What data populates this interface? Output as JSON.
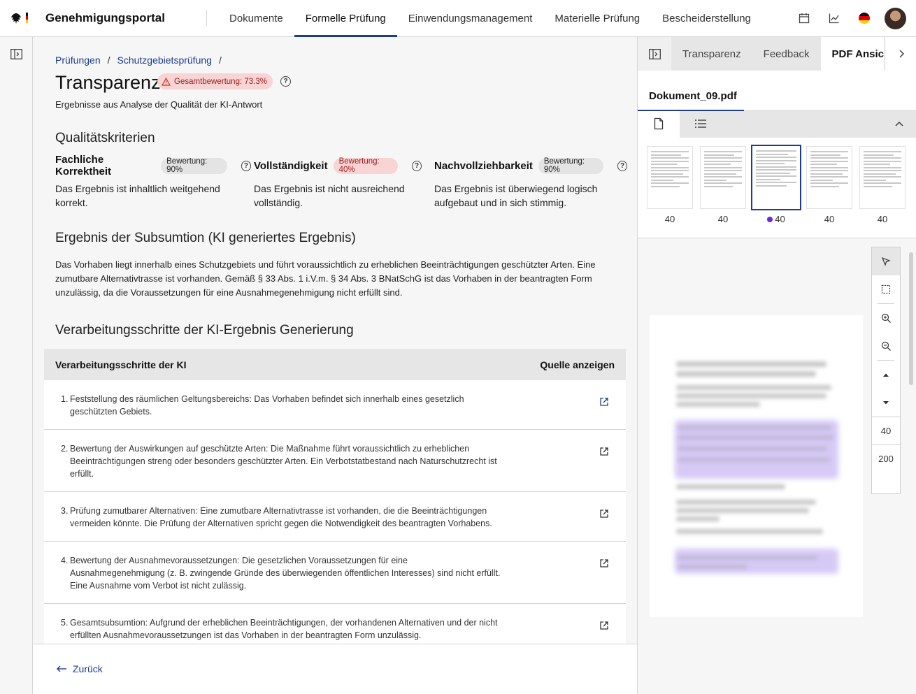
{
  "header": {
    "brand": "Genehmigungsportal",
    "nav": [
      "Dokumente",
      "Formelle Prüfung",
      "Einwendungsmanagement",
      "Materielle Prüfung",
      "Bescheiderstellung"
    ],
    "active_nav": "Formelle Prüfung",
    "icons": [
      "calendar-icon",
      "chart-icon",
      "germany-flag-icon",
      "avatar"
    ]
  },
  "breadcrumb": {
    "items": [
      "Prüfungen",
      "Schutzgebietsprüfung"
    ],
    "separator": "/"
  },
  "page": {
    "title": "Transparenz",
    "overall_badge": "Gesamtbewertung: 73.3%",
    "subtitle": "Ergebnisse aus Analyse der Qualität der KI-Antwort"
  },
  "criteria": {
    "heading": "Qualitätskriterien",
    "items": [
      {
        "name": "Fachliche Korrektheit",
        "score": "Bewertung: 90%",
        "text": "Das Ergebnis ist inhaltlich weitgehend korrekt."
      },
      {
        "name": "Vollständigkeit",
        "score": "Bewertung: 40%",
        "text": "Das Ergebnis ist nicht ausreichend vollständig."
      },
      {
        "name": "Nachvollziehbarkeit",
        "score": "Bewertung: 90%",
        "text": "Das Ergebnis ist überwiegend logisch aufgebaut und in sich stimmig."
      }
    ]
  },
  "result": {
    "heading": "Ergebnis der Subsumtion (KI generiertes Ergebnis)",
    "text": "Das Vorhaben liegt innerhalb eines Schutzgebiets und führt voraussichtlich zu erheblichen Beeinträchtigungen geschützter Arten. Eine zumutbare Alternativtrasse ist vorhanden. Gemäß § 33 Abs. 1 i.V.m. § 34 Abs. 3 BNatSchG ist das Vorhaben in der beantragten Form unzulässig, da die Voraussetzungen für eine Ausnahmegenehmigung nicht erfüllt sind."
  },
  "steps": {
    "heading": "Verarbeitungsschritte der KI-Ergebnis Generierung",
    "col_steps": "Verarbeitungsschritte der KI",
    "col_source": "Quelle anzeigen",
    "rows": [
      {
        "num": "1.",
        "text": "Feststellung des räumlichen Geltungsbereichs: Das Vorhaben befindet sich innerhalb eines gesetzlich geschützten Gebiets."
      },
      {
        "num": "2.",
        "text": "Bewertung der Auswirkungen auf geschützte Arten: Die Maßnahme führt voraussichtlich zu erheblichen Beeinträchtigungen streng oder besonders geschützter Arten. Ein Verbotstatbestand nach Naturschutzrecht ist erfüllt."
      },
      {
        "num": "3.",
        "text": "Prüfung zumutbarer Alternativen: Eine zumutbare Alternativtrasse ist vorhanden, die die Beeinträchtigungen vermeiden könnte. Die Prüfung der Alternativen spricht gegen die Notwendigkeit des beantragten Vorhabens."
      },
      {
        "num": "4.",
        "text": "Bewertung der Ausnahmevoraussetzungen: Die gesetzlichen Voraussetzungen für eine Ausnahmegenehmigung (z. B. zwingende Gründe des überwiegenden öffentlichen Interesses) sind nicht erfüllt. Eine Ausnahme vom Verbot ist nicht zulässig."
      },
      {
        "num": "5.",
        "text": "Gesamtsubsumtion: Aufgrund der erheblichen Beeinträchtigungen, der vorhandenen Alternativen und der nicht erfüllten Ausnahmevoraussetzungen ist das Vorhaben in der beantragten Form unzulässig."
      }
    ]
  },
  "footer": {
    "back": "Zurück"
  },
  "panel": {
    "tabs": [
      "Transparenz",
      "Feedback",
      "PDF Ansicht"
    ],
    "active_tab": "PDF Ansicht",
    "file_name": "Dokument_09.pdf",
    "thumb_pages": [
      "40",
      "40",
      "40",
      "40",
      "40"
    ],
    "selected_thumb": 2,
    "page_number": "40",
    "page_total": "200",
    "accent": "#1a3d8f",
    "highlight": "#c9b8f3",
    "marker": "#6a2bd4"
  }
}
